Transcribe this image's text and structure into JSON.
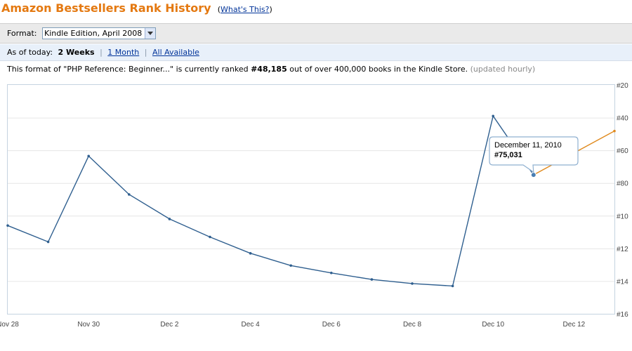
{
  "header": {
    "title": "Amazon Bestsellers Rank History",
    "whats_open": "(",
    "whats_link": "What's This?",
    "whats_close": ")"
  },
  "format": {
    "label": "Format:",
    "selected": "Kindle Edition, April 2008"
  },
  "range": {
    "label": "As of today:",
    "current": "2 Weeks",
    "link1": "1 Month",
    "link2": "All Available"
  },
  "rank_text": {
    "pre": "This format of \"PHP Reference: Beginner...\" is currently ranked ",
    "rank": "#48,185",
    "post": " out of over 400,000 books in the Kindle Store.",
    "updated": "(updated hourly)"
  },
  "tooltip": {
    "date": "December 11, 2010",
    "rank": "#75,031"
  },
  "colors": {
    "title": "#e47911",
    "series_main": "#2f5f8f",
    "series_recent": "#e08a1e",
    "grid": "#e6e6e6",
    "plot_border": "#c5d3e0"
  },
  "chart_data": {
    "type": "line",
    "xlabel": "",
    "ylabel": "",
    "x_tick_labels": [
      "Nov 28",
      "Nov 30",
      "Dec 2",
      "Dec 4",
      "Dec 6",
      "Dec 8",
      "Dec 10",
      "Dec 12"
    ],
    "y_tick_labels": [
      "#20",
      "#40",
      "#60",
      "#80",
      "#10",
      "#12",
      "#14",
      "#16"
    ],
    "y_tick_values": [
      20000,
      40000,
      60000,
      80000,
      100000,
      120000,
      140000,
      160000
    ],
    "y_reversed": true,
    "grid": true,
    "x_range_days": [
      0,
      15
    ],
    "y_range": [
      20000,
      160000
    ],
    "series": [
      {
        "points": [
          {
            "x_day": 0,
            "y": 106000
          },
          {
            "x_day": 1,
            "y": 116000
          },
          {
            "x_day": 2,
            "y": 63500
          },
          {
            "x_day": 3,
            "y": 87000
          },
          {
            "x_day": 4,
            "y": 102000
          },
          {
            "x_day": 5,
            "y": 113000
          },
          {
            "x_day": 6,
            "y": 123000
          },
          {
            "x_day": 7,
            "y": 130500
          },
          {
            "x_day": 8,
            "y": 135000
          },
          {
            "x_day": 9,
            "y": 139000
          },
          {
            "x_day": 10,
            "y": 141500
          },
          {
            "x_day": 11,
            "y": 143000
          },
          {
            "x_day": 12,
            "y": 39000
          },
          {
            "x_day": 13,
            "y": 75031
          }
        ]
      },
      {
        "points": [
          {
            "x_day": 13,
            "y": 75031
          },
          {
            "x_day": 15,
            "y": 48185
          }
        ]
      }
    ]
  }
}
